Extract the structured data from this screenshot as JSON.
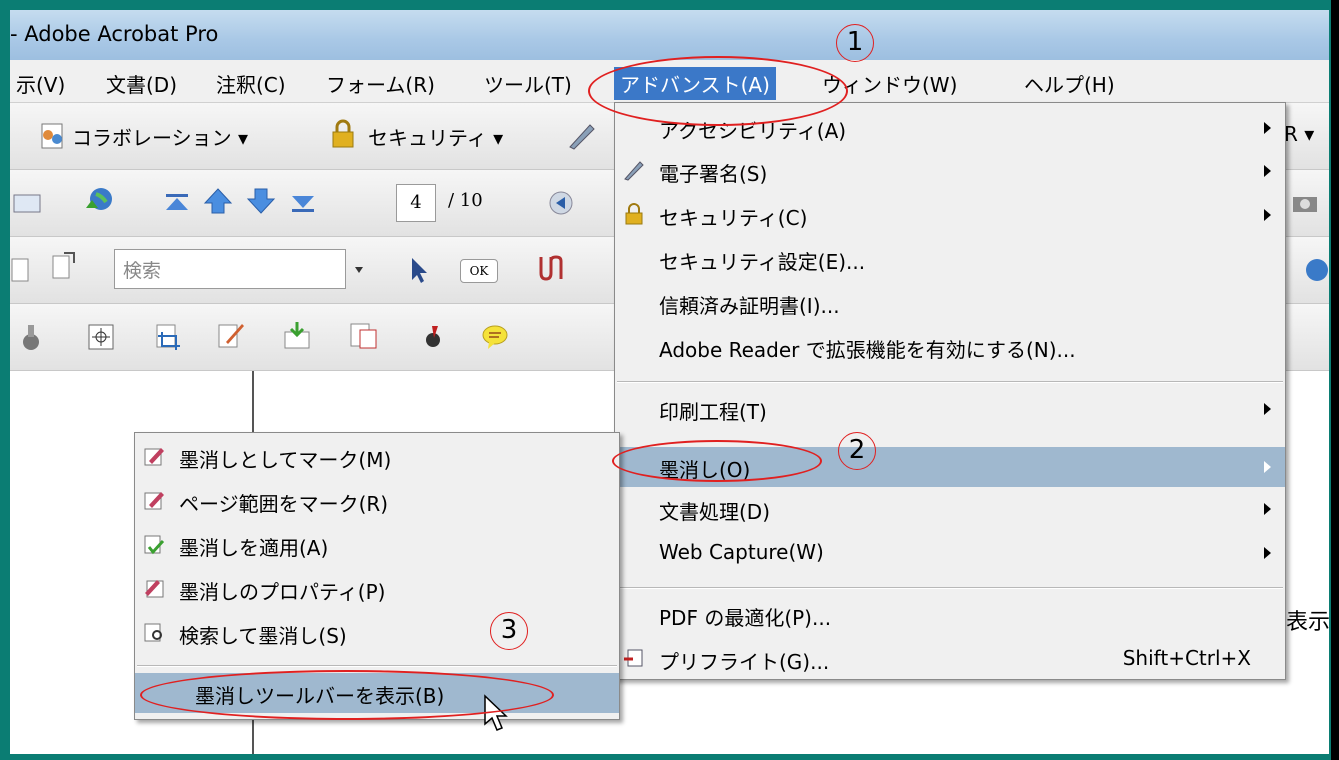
{
  "window": {
    "title": "- Adobe Acrobat Pro"
  },
  "menubar": {
    "items": [
      {
        "label": "示(V)"
      },
      {
        "label": "文書(D)"
      },
      {
        "label": "注釈(C)"
      },
      {
        "label": "フォーム(R)"
      },
      {
        "label": "ツール(T)"
      },
      {
        "label": "アドバンスト(A)"
      },
      {
        "label": "ウィンドウ(W)"
      },
      {
        "label": "ヘルプ(H)"
      }
    ]
  },
  "toolbar1": {
    "collab": "コラボレーション ▾",
    "security": "セキュリティ ▾",
    "right_fragment": "R ▾"
  },
  "toolbar2": {
    "page_current": "4",
    "page_total": "/ 10"
  },
  "toolbar3": {
    "search_placeholder": "検索",
    "ok": "OK"
  },
  "advanced_menu": {
    "items": [
      {
        "label": "アクセシビリティ(A)",
        "submenu": true
      },
      {
        "label": "電子署名(S)",
        "submenu": true
      },
      {
        "label": "セキュリティ(C)",
        "submenu": true
      },
      {
        "label": "セキュリティ設定(E)..."
      },
      {
        "label": "信頼済み証明書(I)..."
      },
      {
        "label": "Adobe Reader で拡張機能を有効にする(N)..."
      },
      {
        "label": "印刷工程(T)",
        "submenu": true
      },
      {
        "label": "墨消し(O)",
        "submenu": true
      },
      {
        "label": "文書処理(D)",
        "submenu": true
      },
      {
        "label": "Web Capture(W)",
        "submenu": true
      },
      {
        "label": "PDF の最適化(P)..."
      },
      {
        "label": "プリフライト(G)...",
        "shortcut": "Shift+Ctrl+X"
      }
    ]
  },
  "redact_menu": {
    "items": [
      {
        "label": "墨消しとしてマーク(M)"
      },
      {
        "label": "ページ範囲をマーク(R)"
      },
      {
        "label": "墨消しを適用(A)"
      },
      {
        "label": "墨消しのプロパティ(P)"
      },
      {
        "label": "検索して墨消し(S)"
      },
      {
        "label": "墨消しツールバーを表示(B)"
      }
    ]
  },
  "annotations": {
    "step1": "1",
    "step2": "2",
    "step3": "3"
  },
  "doc": {
    "edge_text": "表示"
  },
  "colors": {
    "frame": "#0b7d73",
    "menu_highlight": "#3b78c8",
    "submenu_highlight": "#9fb8cf",
    "annotation": "#e02020"
  }
}
